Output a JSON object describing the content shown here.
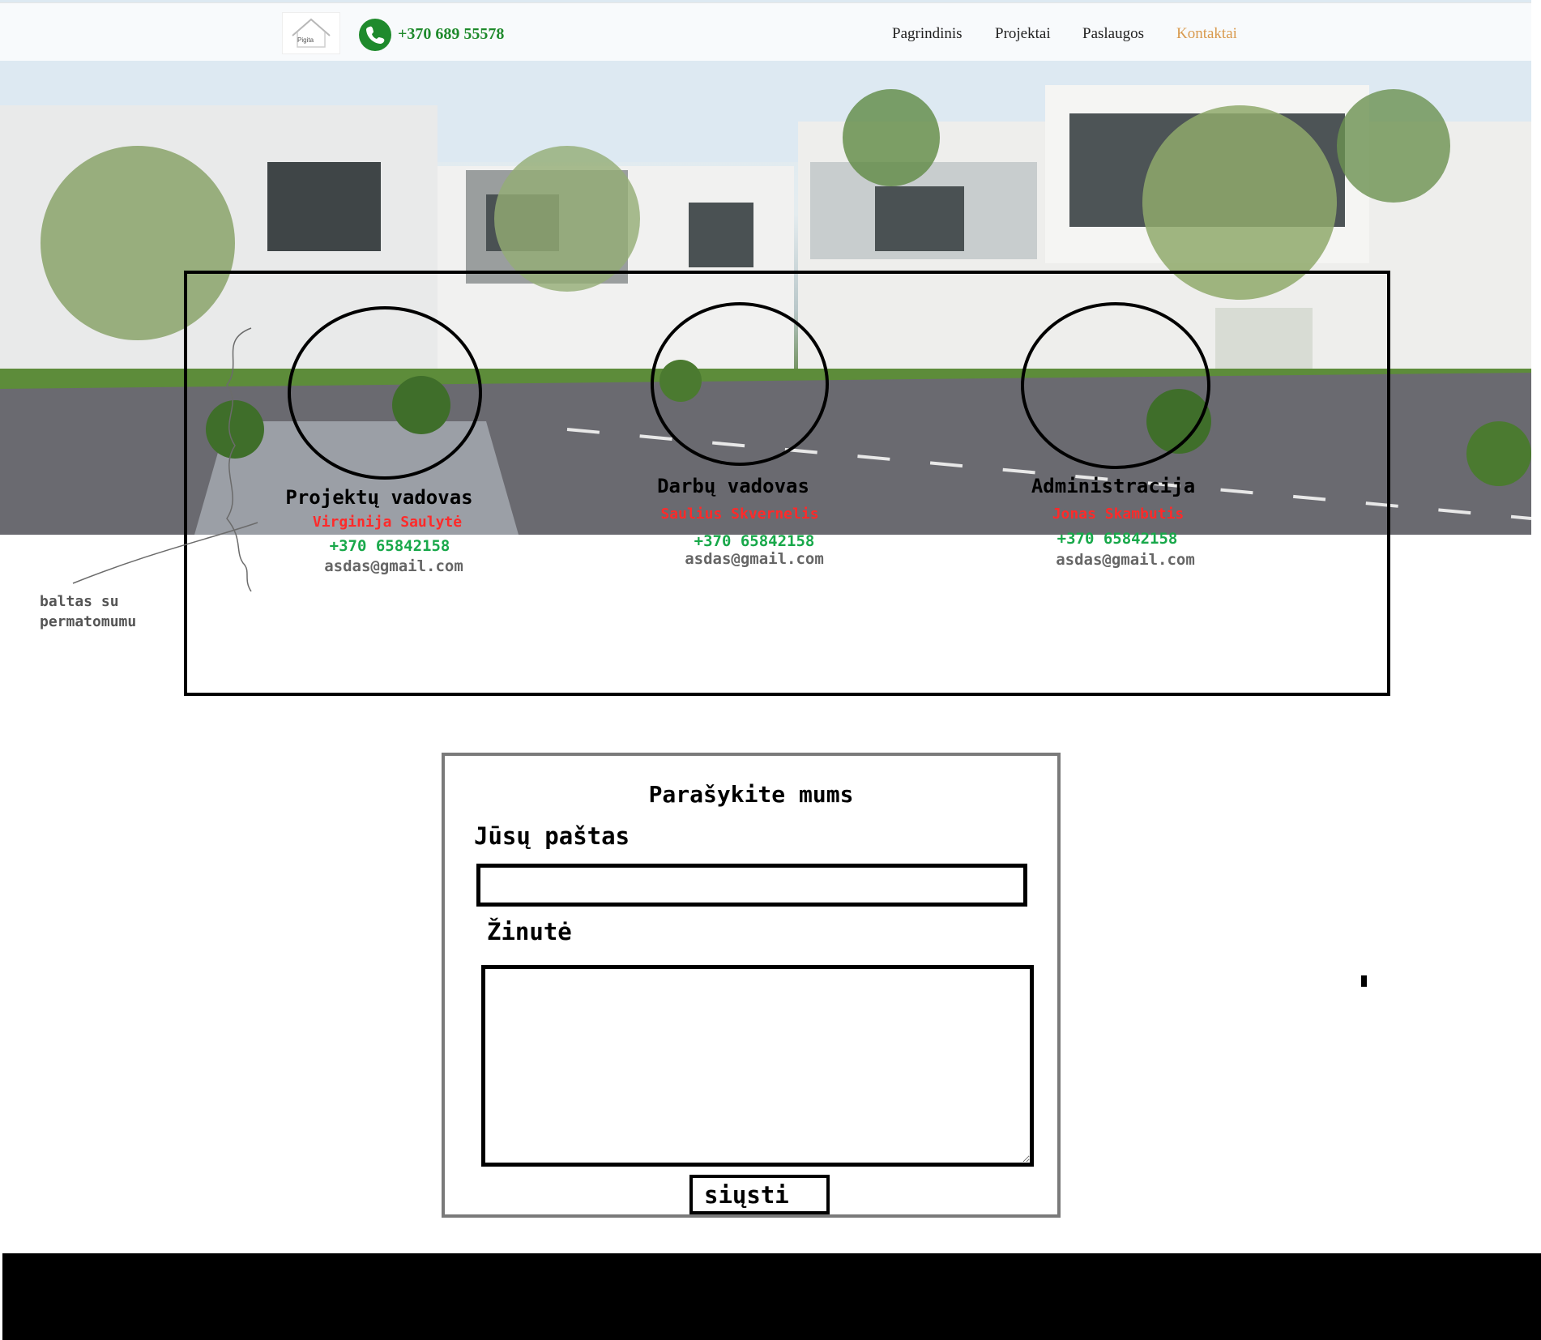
{
  "header": {
    "logo_text": "Pigita",
    "phone": "+370 689 55578",
    "nav": [
      {
        "label": "Pagrindinis",
        "active": false
      },
      {
        "label": "Projektai",
        "active": false
      },
      {
        "label": "Paslaugos",
        "active": false
      },
      {
        "label": "Kontaktai",
        "active": true
      }
    ]
  },
  "contacts": [
    {
      "role": "Projektų vadovas",
      "name": "Virginija Saulytė",
      "phone": "+370 65842158",
      "email": "asdas@gmail.com"
    },
    {
      "role": "Darbų vadovas",
      "name": "Saulius Skvernelis",
      "phone": "+370 65842158",
      "email": "asdas@gmail.com"
    },
    {
      "role": "Administracija",
      "name": "Jonas Skambutis",
      "phone": "+370 65842158",
      "email": "asdas@gmail.com"
    }
  ],
  "annotation": "baltas su\npermatomumu",
  "form": {
    "title": "Parašykite mums",
    "email_label": "Jūsų paštas",
    "email_value": "",
    "message_label": "Žinutė",
    "message_value": "",
    "submit_label": "siųsti"
  },
  "colors": {
    "phone_green": "#1f8a2c",
    "nav_active": "#d99a4e",
    "contact_name": "#ff2a2a",
    "contact_phone": "#18a84a"
  }
}
